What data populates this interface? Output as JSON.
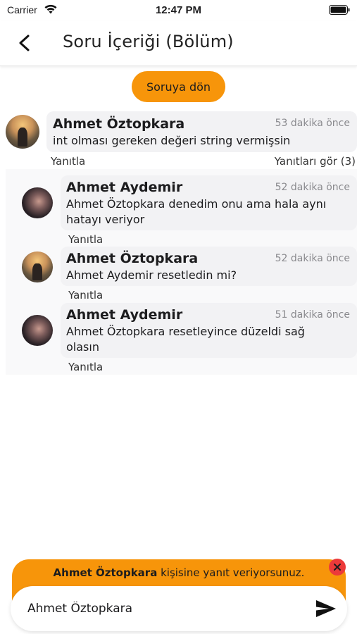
{
  "status_bar": {
    "carrier": "Carrier",
    "time": "12:47 PM"
  },
  "nav": {
    "title": "Soru İçeriği (Bölüm)"
  },
  "back_to_question": "Soruya dön",
  "root_comment": {
    "author": "Ahmet Öztopkara",
    "time": "53 dakika önce",
    "text": "int olması gereken değeri string vermişsin",
    "reply_label": "Yanıtla",
    "view_replies_label": "Yanıtları gör (3)"
  },
  "replies": [
    {
      "author": "Ahmet Aydemir",
      "time": "52 dakika önce",
      "text_line1": "Ahmet Öztopkara denedim onu ama hala aynı",
      "text_line2": "hatayı veriyor",
      "reply_label": "Yanıtla"
    },
    {
      "author": "Ahmet Öztopkara",
      "time": "52 dakika önce",
      "text_line1": "Ahmet Aydemir resetledin mi?",
      "reply_label": "Yanıtla"
    },
    {
      "author": "Ahmet Aydemir",
      "time": "51 dakika önce",
      "text_line1": "Ahmet Öztopkara resetleyince düzeldi sağ",
      "text_line2": "olasın",
      "reply_label": "Yanıtla"
    }
  ],
  "reply_banner": {
    "name": "Ahmet Öztopkara",
    "suffix": " kişisine yanıt veriyorsunuz."
  },
  "input": {
    "value": "Ahmet Öztopkara"
  },
  "colors": {
    "accent": "#f7950a",
    "close": "#ec3a3a",
    "bubble": "#f2f2f4"
  },
  "icons": {
    "back": "chevron-left-icon",
    "send": "send-icon",
    "close": "close-icon",
    "wifi": "wifi-icon",
    "battery": "battery-icon"
  }
}
